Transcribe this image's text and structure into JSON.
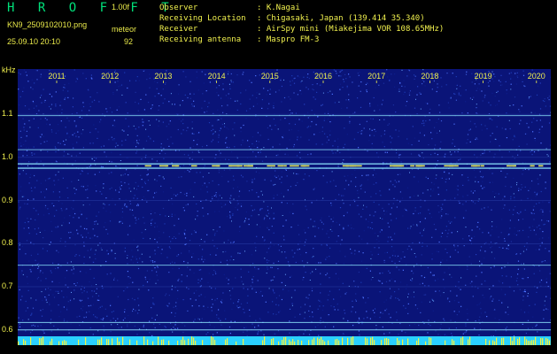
{
  "header": {
    "app_name": "H R O F F T",
    "version": "1.00f",
    "file_name": "KN9_2509102010.png",
    "datetime": "25.09.10 20:10",
    "meteor_label": "meteor",
    "meteor_count": "92"
  },
  "info": [
    {
      "key": "Observer",
      "value": ": K.Nagai"
    },
    {
      "key": "Receiving Location",
      "value": ": Chigasaki, Japan (139.414 35.340)"
    },
    {
      "key": "Receiver",
      "value": ": AirSpy mini (Miakejima VOR 108.65MHz)"
    },
    {
      "key": "Receiving antenna",
      "value": ": Maspro FM-3"
    }
  ],
  "axis": {
    "unit": "kHz",
    "y_ticks": [
      "1.1",
      "1.0",
      "0.9",
      "0.8",
      "0.7",
      "0.6"
    ],
    "y_values": [
      1.1,
      1.0,
      0.9,
      0.8,
      0.7,
      0.6
    ],
    "y_range": [
      0.585,
      1.205
    ],
    "x_ticks": [
      "2011",
      "2012",
      "2013",
      "2014",
      "2015",
      "2016",
      "2017",
      "2018",
      "2019",
      "2020"
    ]
  },
  "colors": {
    "background": "#000000",
    "waterfall_base": "#0a1478",
    "text": "#f0f04e",
    "logo": "#00e07a",
    "carrier_line": "#8ee8ff",
    "marker_bars": "#f4f43a",
    "bottom_band": "#2ad0ff"
  },
  "carrier_lines_khz": [
    1.097,
    1.018,
    0.985,
    0.975,
    0.75,
    0.617,
    0.6
  ]
}
